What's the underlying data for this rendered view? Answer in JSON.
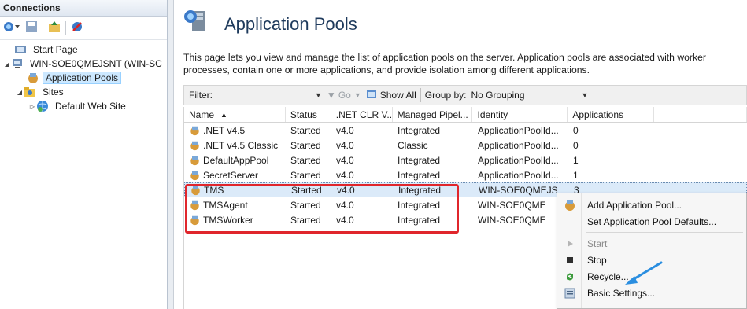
{
  "connections": {
    "header": "Connections",
    "tree": [
      {
        "label": "Start Page",
        "level": 1,
        "icon": "start-page-icon"
      },
      {
        "label": "WIN-SOE0QMEJSNT (WIN-SC",
        "level": 0,
        "icon": "server-icon"
      },
      {
        "label": "Application Pools",
        "level": 2,
        "icon": "app-pools-icon",
        "selected": true
      },
      {
        "label": "Sites",
        "level": 1,
        "icon": "sites-folder-icon"
      },
      {
        "label": "Default Web Site",
        "level": 2,
        "icon": "globe-icon"
      }
    ]
  },
  "main": {
    "title": "Application Pools",
    "description": "This page lets you view and manage the list of application pools on the server. Application pools are associated with worker processes, contain one or more applications, and provide isolation among different applications."
  },
  "filterbar": {
    "filter_label": "Filter:",
    "go_label": "Go",
    "show_all_label": "Show All",
    "group_by_label": "Group by:",
    "group_by_value": "No Grouping"
  },
  "grid": {
    "columns": [
      "Name",
      "Status",
      ".NET CLR V...",
      "Managed Pipel...",
      "Identity",
      "Applications"
    ],
    "rows": [
      {
        "name": ".NET v4.5",
        "status": "Started",
        "clr": "v4.0",
        "pipeline": "Integrated",
        "identity": "ApplicationPoolId...",
        "apps": "0"
      },
      {
        "name": ".NET v4.5 Classic",
        "status": "Started",
        "clr": "v4.0",
        "pipeline": "Classic",
        "identity": "ApplicationPoolId...",
        "apps": "0"
      },
      {
        "name": "DefaultAppPool",
        "status": "Started",
        "clr": "v4.0",
        "pipeline": "Integrated",
        "identity": "ApplicationPoolId...",
        "apps": "1"
      },
      {
        "name": "SecretServer",
        "status": "Started",
        "clr": "v4.0",
        "pipeline": "Integrated",
        "identity": "ApplicationPoolId...",
        "apps": "1"
      },
      {
        "name": "TMS",
        "status": "Started",
        "clr": "v4.0",
        "pipeline": "Integrated",
        "identity": "WIN-SOE0QMEJS",
        "apps": "3"
      },
      {
        "name": "TMSAgent",
        "status": "Started",
        "clr": "v4.0",
        "pipeline": "Integrated",
        "identity": "WIN-SOE0QME",
        "apps": ""
      },
      {
        "name": "TMSWorker",
        "status": "Started",
        "clr": "v4.0",
        "pipeline": "Integrated",
        "identity": "WIN-SOE0QME",
        "apps": ""
      }
    ]
  },
  "context_menu": {
    "items": [
      {
        "label": "Add Application Pool...",
        "icon": "add-pool-icon"
      },
      {
        "label": "Set Application Pool Defaults...",
        "icon": ""
      },
      {
        "label": "Start",
        "icon": "start-icon",
        "disabled": true
      },
      {
        "label": "Stop",
        "icon": "stop-icon"
      },
      {
        "label": "Recycle...",
        "icon": "recycle-icon"
      },
      {
        "label": "Basic Settings...",
        "icon": "basic-settings-icon"
      }
    ]
  },
  "colors": {
    "highlight_box": "#e0262c",
    "annotation_arrow": "#2a8ee0",
    "selection": "#dbeaf9"
  }
}
